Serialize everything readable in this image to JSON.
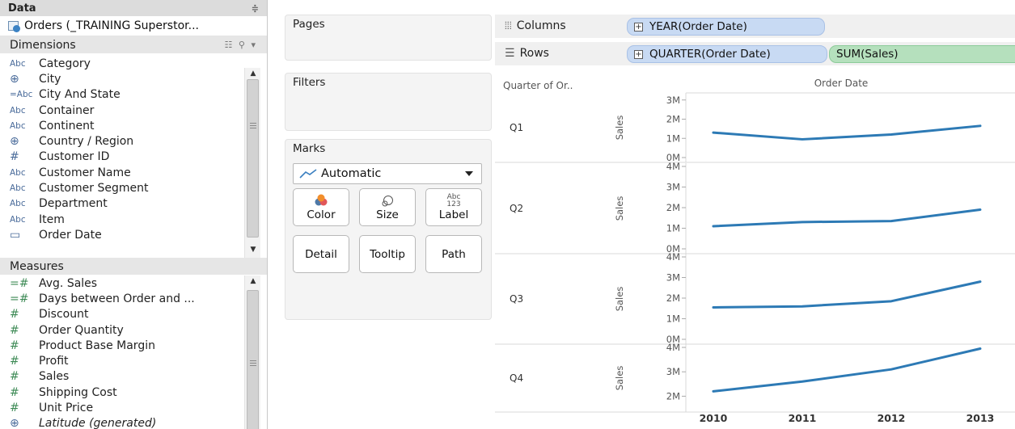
{
  "data_pane": {
    "title": "Data",
    "datasource": "Orders (_TRAINING Superstor...",
    "dimensions_title": "Dimensions",
    "dimensions": [
      {
        "type": "Abc",
        "name": "Category"
      },
      {
        "type": "geo",
        "name": "City"
      },
      {
        "type": "=Abc",
        "name": "City And State"
      },
      {
        "type": "Abc",
        "name": "Container"
      },
      {
        "type": "Abc",
        "name": "Continent"
      },
      {
        "type": "geo",
        "name": "Country / Region"
      },
      {
        "type": "#",
        "name": "Customer ID"
      },
      {
        "type": "Abc",
        "name": "Customer Name"
      },
      {
        "type": "Abc",
        "name": "Customer Segment"
      },
      {
        "type": "Abc",
        "name": "Department"
      },
      {
        "type": "Abc",
        "name": "Item"
      },
      {
        "type": "date",
        "name": "Order Date"
      }
    ],
    "measures_title": "Measures",
    "measures": [
      {
        "type": "=#",
        "name": "Avg. Sales"
      },
      {
        "type": "=#",
        "name": "Days between Order and ..."
      },
      {
        "type": "#",
        "name": "Discount"
      },
      {
        "type": "#",
        "name": "Order Quantity"
      },
      {
        "type": "#",
        "name": "Product Base Margin"
      },
      {
        "type": "#",
        "name": "Profit"
      },
      {
        "type": "#",
        "name": "Sales"
      },
      {
        "type": "#",
        "name": "Shipping Cost"
      },
      {
        "type": "#",
        "name": "Unit Price"
      },
      {
        "type": "geo",
        "name": "Latitude (generated)",
        "italic": true
      }
    ]
  },
  "cards": {
    "pages_title": "Pages",
    "filters_title": "Filters",
    "marks_title": "Marks",
    "mark_type": "Automatic",
    "buttons": {
      "color": "Color",
      "size": "Size",
      "label": "Label",
      "label_glyph": "Abc\n123",
      "detail": "Detail",
      "tooltip": "Tooltip",
      "path": "Path"
    }
  },
  "shelves": {
    "columns_label": "Columns",
    "rows_label": "Rows",
    "columns_pills": [
      "YEAR(Order Date)"
    ],
    "rows_pills": [
      "QUARTER(Order Date)",
      "SUM(Sales)"
    ]
  },
  "view": {
    "row_header_title": "Quarter of Or..",
    "column_header_title": "Order Date",
    "measure_axis_title": "Sales",
    "line_color": "#2d7ab5"
  },
  "chart_data": {
    "type": "line",
    "x": [
      "2010",
      "2011",
      "2012",
      "2013"
    ],
    "facet_field": "Quarter of Order Date",
    "panes": [
      {
        "quarter": "Q1",
        "ticks": [
          "0M",
          "1M",
          "2M",
          "3M"
        ],
        "ylim": [
          0,
          3.2
        ],
        "values": [
          1.3,
          0.95,
          1.2,
          1.65
        ]
      },
      {
        "quarter": "Q2",
        "ticks": [
          "0M",
          "1M",
          "2M",
          "3M",
          "4M"
        ],
        "ylim": [
          0,
          4.0
        ],
        "values": [
          1.1,
          1.3,
          1.35,
          1.9
        ]
      },
      {
        "quarter": "Q3",
        "ticks": [
          "0M",
          "1M",
          "2M",
          "3M",
          "4M"
        ],
        "ylim": [
          0,
          4.0
        ],
        "values": [
          1.55,
          1.6,
          1.85,
          2.8
        ]
      },
      {
        "quarter": "Q4",
        "ticks": [
          "2M",
          "3M",
          "4M"
        ],
        "ylim": [
          1.55,
          4.0
        ],
        "values": [
          2.2,
          2.6,
          3.1,
          3.95
        ]
      }
    ]
  }
}
